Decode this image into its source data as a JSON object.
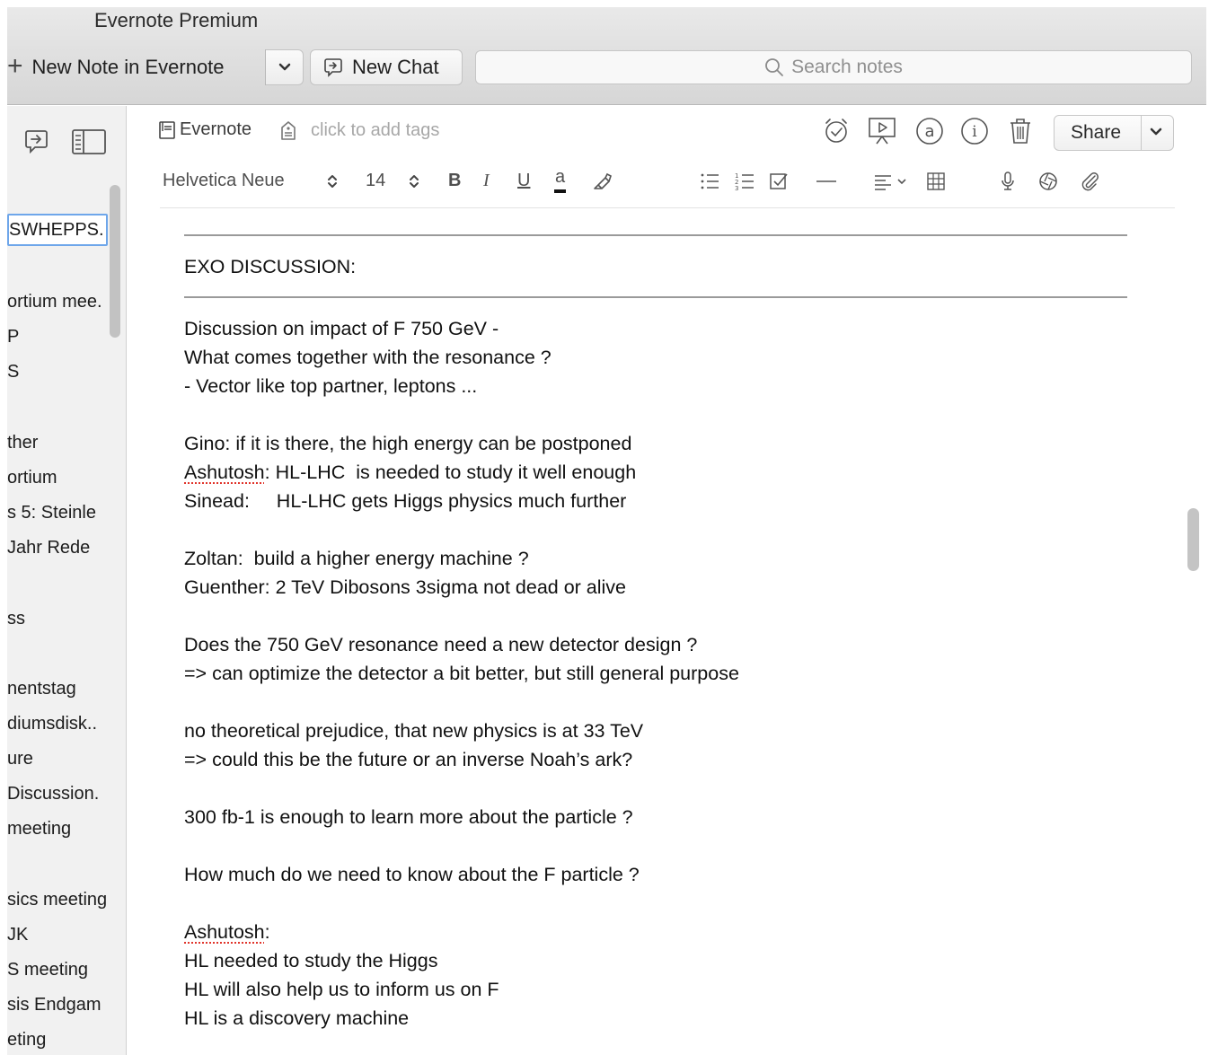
{
  "window": {
    "title": "Evernote Premium"
  },
  "toolbar": {
    "new_note_label": "New Note in Evernote",
    "new_chat_label": "New Chat",
    "search_placeholder": "Search notes"
  },
  "sidebar": {
    "selected_item": "SWHEPPS.",
    "items": [
      {
        "label": "ortium mee."
      },
      {
        "label": "P"
      },
      {
        "label": "S"
      },
      {
        "label": "ther"
      },
      {
        "label": "ortium"
      },
      {
        "label": "s 5: Steinle"
      },
      {
        "label": "Jahr Rede"
      },
      {
        "label": "ss"
      },
      {
        "label": "nentstag"
      },
      {
        "label": "diumsdisk.."
      },
      {
        "label": "ure"
      },
      {
        "label": "Discussion."
      },
      {
        "label": "meeting"
      },
      {
        "label": "sics meeting"
      },
      {
        "label": "JK"
      },
      {
        "label": "S meeting"
      },
      {
        "label": "sis Endgam"
      },
      {
        "label": "eting"
      }
    ]
  },
  "note_meta": {
    "notebook": "Evernote",
    "tags_placeholder": "click to add tags",
    "share_label": "Share"
  },
  "format_bar": {
    "font_family": "Helvetica Neue",
    "font_size": "14",
    "bold": "B",
    "italic": "I",
    "underline": "U",
    "text_color": "a"
  },
  "note": {
    "heading": "EXO DISCUSSION:",
    "lines": [
      "Discussion on impact of F 750 GeV -",
      "What comes together with the resonance ?",
      "- Vector like top partner, leptons ...",
      "",
      "Gino: if it is there, the high energy can be postponed",
      "Ashutosh: HL-LHC  is needed to study it well enough",
      "Sinead:     HL-LHC gets Higgs physics much further",
      "",
      "Zoltan:  build a higher energy machine ?",
      "Guenther: 2 TeV Dibosons 3sigma not dead or alive",
      "",
      "Does the 750 GeV resonance need a new detector design ?",
      "=> can optimize the detector a bit better, but still general purpose",
      "",
      "no theoretical prejudice, that new physics is at 33 TeV",
      "=> could this be the future or an inverse Noah’s ark?",
      "",
      "300 fb-1 is enough to learn more about the particle ?",
      "",
      "How much do we need to know about the F particle ?",
      "",
      "Ashutosh:",
      "HL needed to study the Higgs",
      "HL will also help us to inform us on F",
      "HL is a discovery machine"
    ]
  }
}
